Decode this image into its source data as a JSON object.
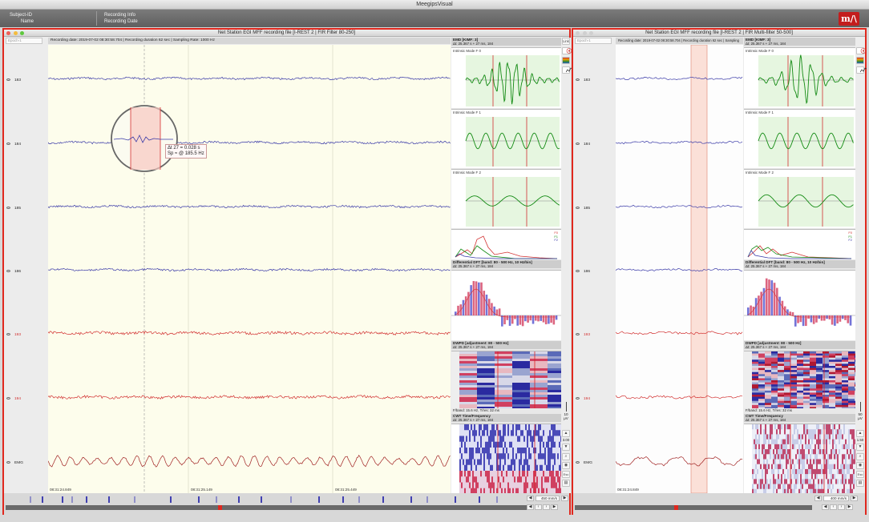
{
  "app": {
    "title": "MeegipsVisual",
    "logo": "m/\\"
  },
  "infobar": {
    "subject_id_label": "Subject-ID",
    "name_label": "Name",
    "recording_info_label": "Recording Info",
    "recording_date_label": "Recording Date"
  },
  "left_window": {
    "title": "Net Station EGI MFF recording file [I-REST 2 | FIR Filter 80-250]",
    "epoch_placeholder": "Epoch-1",
    "recording_line": "Recording date: 2019-07-02 08:30:58.704  |  Recording duration 62 sec  |  Sampling Rate: 1000 Hz",
    "channels": [
      "183",
      "184",
      "185",
      "186",
      "193",
      "194",
      "EMG"
    ],
    "time_ticks": [
      "08:31:24.849",
      "08:31:25.149",
      "08:31:25.449"
    ],
    "tooltip_line1": "Δt 27 = 0.028 s",
    "tooltip_line2": "Sp ≈ @ 185.5 Hz",
    "link_label": "Link",
    "emd_title": "EMD [KIMF: 3]",
    "emd_sub": "Δt: 25.367 s + 27 ms, 184",
    "imf0_label": "Intrinsic Mode F 0",
    "imf1_label": "Intrinsic Mode F 1",
    "imf2_label": "Intrinsic Mode F 2",
    "legend": [
      "F0",
      "F1",
      "F2"
    ],
    "dft_title": "Differential DFT [band: 80 - 500 Hz, 10 Hz/bin]",
    "dft_sub": "Δt: 25.367 s + 27 ms, 184",
    "dwpd_title": "DWPD [adjustment: 80 - 500 Hz]",
    "dwpd_sub": "Δt: 25.367 s + 27 ms, 184",
    "dwpd_footer": "F/band: 15.6 Hz, T/res: 32 ms",
    "cwt_title": "CWT Time/Frequency",
    "cwt_sub": "Δt: 25.367 s + 27 ms, 184",
    "scale_value": "10",
    "scale_unit": "μV",
    "amp_value": "3.00",
    "esc_label": "Esc",
    "speed": "450 mm/s"
  },
  "right_window": {
    "title": "Net Station EGI MFF recording file [I-REST 2 | FIR Multi-filter 50-500]",
    "epoch_placeholder": "Epoch-1",
    "recording_line": "Recording date: 2019-07-02 08:30:58.704  |  Recording duration 62 sec  |  Sampling Rate: 1000 Hz",
    "channels": [
      "183",
      "184",
      "185",
      "186",
      "193",
      "194",
      "EMG"
    ],
    "time_ticks": [
      "08:31:24.849"
    ],
    "emd_title": "EMD [KIMF: 3]",
    "emd_sub": "Δt: 25.367 s + 27 ms, 184",
    "imf0_label": "Intrinsic Mode F 0",
    "imf1_label": "Intrinsic Mode F 1",
    "imf2_label": "Intrinsic Mode F 2",
    "legend": [
      "F0",
      "F1",
      "F2"
    ],
    "dft_title": "Differential DFT [band: 80 - 500 Hz, 10 Hz/bin]",
    "dft_sub": "Δt: 25.367 s + 27 ms, 184",
    "dwpd_title": "DWPD [adjustment: 80 - 500 Hz]",
    "dwpd_sub": "Δt: 25.367 s + 27 ms, 184",
    "dwpd_footer": "F/band: 15.6 Hz, T/res: 32 ms",
    "cwt_title": "CWT Time/Frequency",
    "cwt_sub": "Δt: 25.367 s + 27 ms, 184",
    "scale_value": "50",
    "scale_unit": "μV",
    "amp_value": "1.50",
    "esc_label": "Esc",
    "speed": "400 mm/s"
  },
  "nav": {
    "first": "◀",
    "prev": "‹",
    "next": "›",
    "last": "▶"
  },
  "colors": {
    "accent": "#e0281e",
    "trace_blue": "#3a3aa8",
    "trace_red": "#d23030",
    "emg": "#a02020",
    "imf_green": "#128a12",
    "plot_bg": "#fdfdec",
    "imf_bg": "#e6f6e0"
  },
  "icons": [
    "head-map-icon",
    "spectrum-icon",
    "chart-icon",
    "eye-icon",
    "zoom-icon",
    "print-icon"
  ]
}
